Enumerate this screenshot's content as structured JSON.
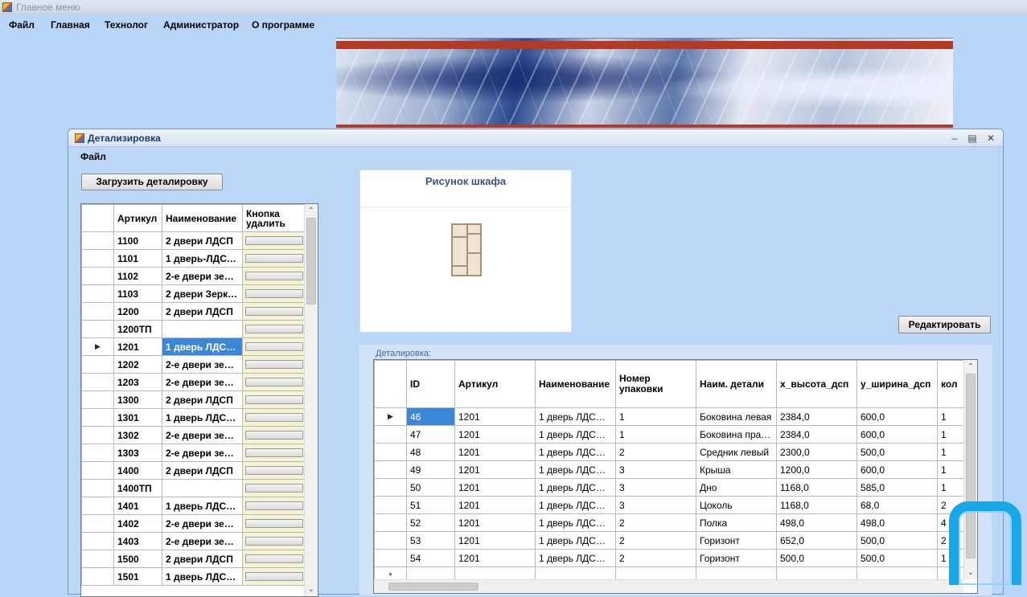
{
  "main_window": {
    "title": "Главное меню",
    "menu": [
      "Файл",
      "Главная",
      "Технолог",
      "Администратор",
      "О программе"
    ]
  },
  "child_window": {
    "title": "Детализировка",
    "menu_file": "Файл",
    "load_button": "Загрузить деталировку",
    "edit_button": "Редактировать",
    "picture_title": "Рисунок шкафа",
    "group_label": "Деталировка:",
    "left_table": {
      "headers": [
        "Артикул",
        "Наименование",
        "Кнопка удалить"
      ],
      "selected_row": 6,
      "rows": [
        [
          "1100",
          "2 двери ЛДСП"
        ],
        [
          "1101",
          "1 дверь-ЛДСП, ..."
        ],
        [
          "1102",
          "2-е двери зерк..."
        ],
        [
          "1103",
          "2 двери Зеркал..."
        ],
        [
          "1200",
          "2 двери ЛДСП"
        ],
        [
          "1200ТП",
          ""
        ],
        [
          "1201",
          "1 дверь ЛДСП, ..."
        ],
        [
          "1202",
          "2-е двери зерк..."
        ],
        [
          "1203",
          "2-е двери зерк..."
        ],
        [
          "1300",
          "2 двери ЛДСП"
        ],
        [
          "1301",
          "1 дверь ЛДСП, ..."
        ],
        [
          "1302",
          "2-е двери зерк..."
        ],
        [
          "1303",
          "2-е двери зерк..."
        ],
        [
          "1400",
          "2 двери ЛДСП"
        ],
        [
          "1400ТП",
          ""
        ],
        [
          "1401",
          "1 дверь ЛДСП, ..."
        ],
        [
          "1402",
          "2-е двери зерк..."
        ],
        [
          "1403",
          "2-е двери зерк..."
        ],
        [
          "1500",
          "2 двери ЛДСП"
        ],
        [
          "1501",
          "1 дверь ЛДСП, ..."
        ]
      ]
    },
    "right_table": {
      "headers": [
        "ID",
        "Артикул",
        "Наименование",
        "Номер упаковки",
        "Наим. детали",
        "x_высота_дсп",
        "y_ширина_дсп",
        "кол"
      ],
      "rows": [
        [
          "46",
          "1201",
          "1 дверь ЛДСП, ...",
          "1",
          "Боковина левая",
          "2384,0",
          "600,0",
          "1"
        ],
        [
          "47",
          "1201",
          "1 дверь ЛДСП, ...",
          "1",
          "Боковина прав...",
          "2384,0",
          "600,0",
          "1"
        ],
        [
          "48",
          "1201",
          "1 дверь ЛДСП, ...",
          "2",
          "Средник левый",
          "2300,0",
          "500,0",
          "1"
        ],
        [
          "49",
          "1201",
          "1 дверь ЛДСП, ...",
          "3",
          "Крыша",
          "1200,0",
          "600,0",
          "1"
        ],
        [
          "50",
          "1201",
          "1 дверь ЛДСП, ...",
          "3",
          "Дно",
          "1168,0",
          "585,0",
          "1"
        ],
        [
          "51",
          "1201",
          "1 дверь ЛДСП, ...",
          "3",
          "Цоколь",
          "1168,0",
          "68,0",
          "2"
        ],
        [
          "52",
          "1201",
          "1 дверь ЛДСП, ...",
          "2",
          "Полка",
          "498,0",
          "498,0",
          "4"
        ],
        [
          "53",
          "1201",
          "1 дверь ЛДСП, ...",
          "2",
          "Горизонт",
          "652,0",
          "500,0",
          "2"
        ],
        [
          "54",
          "1201",
          "1 дверь ЛДСП, ...",
          "2",
          "Горизонт",
          "500,0",
          "500,0",
          "1"
        ]
      ],
      "new_row_marker": "*"
    }
  }
}
